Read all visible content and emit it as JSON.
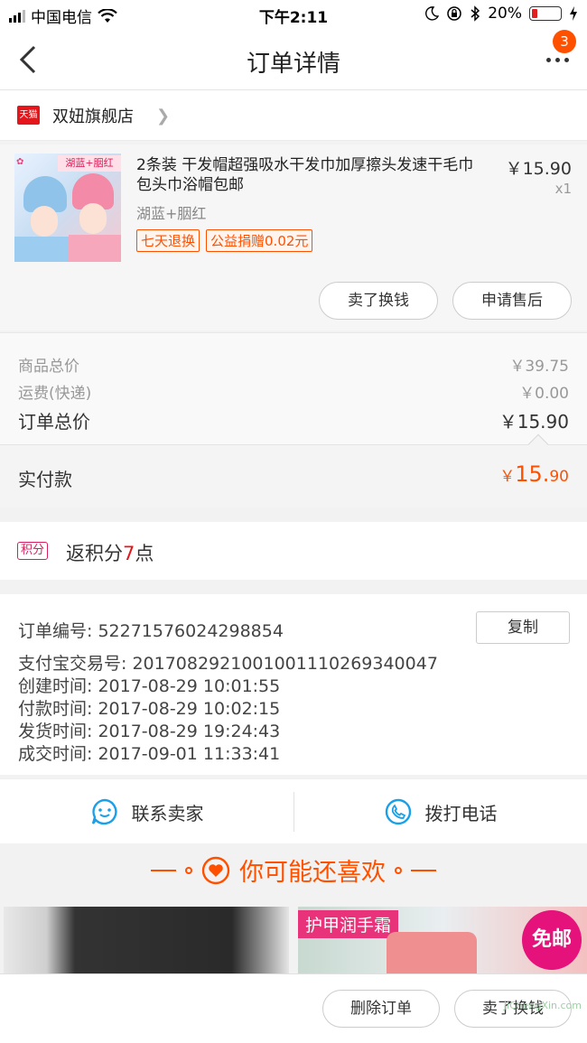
{
  "status_bar": {
    "carrier": "中国电信",
    "time": "下午2:11",
    "battery_percent": "20%",
    "battery_level": 0.2
  },
  "nav": {
    "title": "订单详情",
    "badge_count": "3"
  },
  "shop": {
    "badge": "天猫",
    "name": "双妞旗舰店"
  },
  "product": {
    "image_tag": "湖蓝+胭红",
    "title": "2条装 干发帽超强吸水干发巾加厚擦头发速干毛巾包头巾浴帽包邮",
    "spec": "湖蓝+胭红",
    "tags": [
      "七天退换",
      "公益捐赠0.02元"
    ],
    "price": "￥15.90",
    "qty": "x1",
    "actions": [
      "卖了换钱",
      "申请售后"
    ]
  },
  "costs": {
    "goods_label": "商品总价",
    "goods_value": "￥39.75",
    "shipping_label": "运费(快递)",
    "shipping_value": "￥0.00",
    "total_label": "订单总价",
    "total_value": "￥15.90"
  },
  "paid": {
    "label": "实付款",
    "symbol": "￥",
    "integer": "15.",
    "decimal": "90"
  },
  "points": {
    "chip": "积分",
    "prefix": "返积分",
    "count": "7",
    "suffix": "点"
  },
  "info": {
    "order_no": "订单编号:  52271576024298854",
    "copy_label": "复制",
    "alipay_no": "支付宝交易号:  2017082921001001110269340047",
    "created": "创建时间:  2017-08-29 10:01:55",
    "paid_time": "付款时间:  2017-08-29 10:02:15",
    "shipped": "发货时间:  2017-08-29 19:24:43",
    "completed": "成交时间:  2017-09-01 11:33:41"
  },
  "contact": {
    "seller": "联系卖家",
    "phone": "拨打电话"
  },
  "guess": {
    "title": "你可能还喜欢"
  },
  "recs": {
    "rec2_tag": "护甲润手霜",
    "rec2_free": "免邮"
  },
  "bottom": {
    "delete_label": "删除订单",
    "sell_label": "卖了换钱",
    "watermark": "JiChengXin.com"
  },
  "colors": {
    "accent": "#ff5000",
    "tmall_red": "#e4161b",
    "contact_blue": "#1aa0e8"
  }
}
